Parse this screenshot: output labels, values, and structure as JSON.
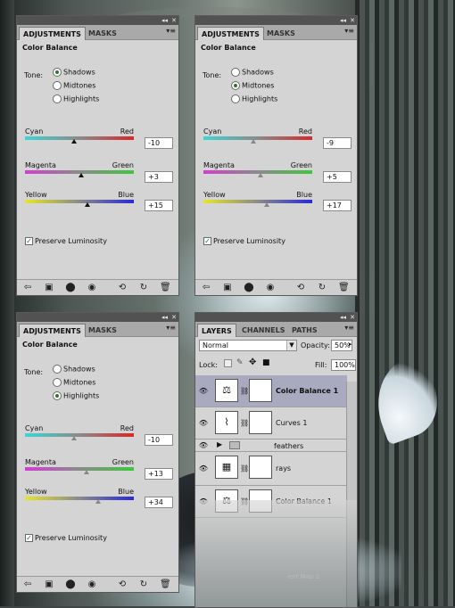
{
  "panels": [
    {
      "tabs": [
        "ADJUSTMENTS",
        "MASKS"
      ],
      "title": "Color Balance",
      "tone_label": "Tone:",
      "tones": [
        "Shadows",
        "Midtones",
        "Highlights"
      ],
      "selected_tone": 0,
      "sliders": [
        {
          "left": "Cyan",
          "right": "Red",
          "value": "-10",
          "pos": -10
        },
        {
          "left": "Magenta",
          "right": "Green",
          "value": "+3",
          "pos": 3
        },
        {
          "left": "Yellow",
          "right": "Blue",
          "value": "+15",
          "pos": 15
        }
      ],
      "preserve": "Preserve Luminosity"
    },
    {
      "tabs": [
        "ADJUSTMENTS",
        "MASKS"
      ],
      "title": "Color Balance",
      "tone_label": "Tone:",
      "tones": [
        "Shadows",
        "Midtones",
        "Highlights"
      ],
      "selected_tone": 1,
      "sliders": [
        {
          "left": "Cyan",
          "right": "Red",
          "value": "-9",
          "pos": -9
        },
        {
          "left": "Magenta",
          "right": "Green",
          "value": "+5",
          "pos": 5
        },
        {
          "left": "Yellow",
          "right": "Blue",
          "value": "+17",
          "pos": 17
        }
      ],
      "preserve": "Preserve Luminosity"
    },
    {
      "tabs": [
        "ADJUSTMENTS",
        "MASKS"
      ],
      "title": "Color Balance",
      "tone_label": "Tone:",
      "tones": [
        "Shadows",
        "Midtones",
        "Highlights"
      ],
      "selected_tone": 2,
      "sliders": [
        {
          "left": "Cyan",
          "right": "Red",
          "value": "-10",
          "pos": -10
        },
        {
          "left": "Magenta",
          "right": "Green",
          "value": "+13",
          "pos": 13
        },
        {
          "left": "Yellow",
          "right": "Blue",
          "value": "+34",
          "pos": 34
        }
      ],
      "preserve": "Preserve Luminosity"
    }
  ],
  "layers_panel": {
    "tabs": [
      "LAYERS",
      "CHANNELS",
      "PATHS"
    ],
    "blend_mode": "Normal",
    "opacity_label": "Opacity:",
    "opacity": "50%",
    "lock_label": "Lock:",
    "fill_label": "Fill:",
    "fill": "100%",
    "layers": [
      {
        "name": "Color Balance 1",
        "bold": true,
        "selected": true,
        "icon": "balance-icon"
      },
      {
        "name": "Curves 1",
        "bold": false,
        "selected": false,
        "icon": "curves-icon"
      },
      {
        "name": "feathers",
        "bold": false,
        "selected": false,
        "icon": "folder-icon"
      },
      {
        "name": "rays",
        "bold": false,
        "selected": false,
        "icon": "image-icon"
      },
      {
        "name": "Color Balance 1",
        "bold": false,
        "selected": false,
        "icon": "balance-icon"
      }
    ],
    "ghost_text": "ent Map 2"
  },
  "colors": {
    "panel_bg": "#d4d4d4",
    "tab_bar": "#a9a9a9",
    "selected_layer": "#a9a9c0"
  }
}
